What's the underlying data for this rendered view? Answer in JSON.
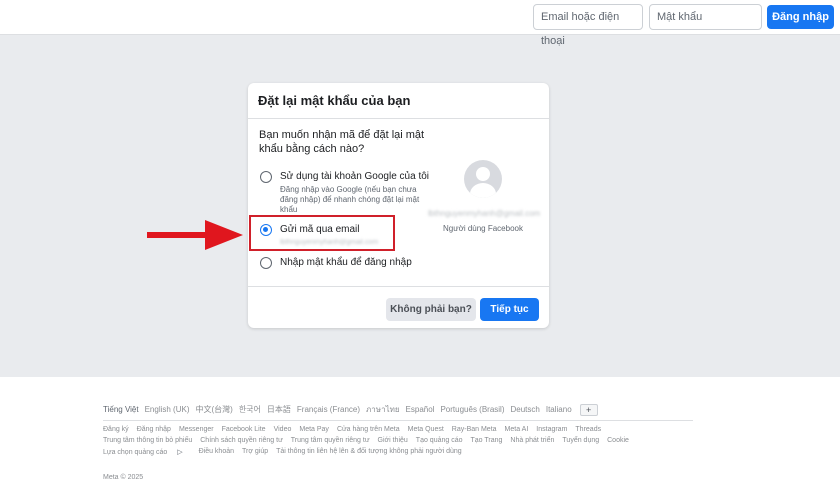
{
  "header": {
    "email_placeholder": "Email hoặc điện thoại",
    "password_placeholder": "Mật khẩu",
    "login_label": "Đăng nhập"
  },
  "card": {
    "title": "Đặt lại mật khẩu của bạn",
    "question": "Bạn muốn nhận mã để đặt lại mật khẩu bằng cách nào?",
    "options": [
      {
        "label": "Sử dụng tài khoản Google của tôi",
        "description": "Đăng nhập vào Google (nếu bạn chưa đăng nhập) để nhanh chóng đặt lại mật khẩu",
        "selected": false
      },
      {
        "label": "Gửi mã qua email",
        "email": "lbthnguyenmyhanh@gmail.com",
        "selected": true
      },
      {
        "label": "Nhập mật khẩu để đăng nhập",
        "selected": false
      }
    ],
    "profile": {
      "email": "lbthnguyenmyhanh@gmail.com",
      "name": "Người dùng Facebook"
    },
    "not_you_label": "Không phải bạn?",
    "continue_label": "Tiếp tục"
  },
  "annotation": {
    "arrow_color": "#e0161e",
    "box_color": "#d0202a"
  },
  "footer": {
    "languages": [
      "Tiếng Việt",
      "English (UK)",
      "中文(台灣)",
      "한국어",
      "日本語",
      "Français (France)",
      "ภาษาไทย",
      "Español",
      "Português (Brasil)",
      "Deutsch",
      "Italiano"
    ],
    "add_language": "+",
    "links_row1": [
      "Đăng ký",
      "Đăng nhập",
      "Messenger",
      "Facebook Lite",
      "Video",
      "Meta Pay",
      "Cửa hàng trên Meta",
      "Meta Quest",
      "Ray-Ban Meta",
      "Meta AI",
      "Instagram",
      "Threads"
    ],
    "links_row2": [
      "Trung tâm thông tin bỏ phiếu",
      "Chính sách quyền riêng tư",
      "Trung tâm quyền riêng tư",
      "Giới thiệu",
      "Tạo quảng cáo",
      "Tạo Trang",
      "Nhà phát triển",
      "Tuyển dụng",
      "Cookie"
    ],
    "links_row3": [
      "Lựa chọn quảng cáo",
      "Điều khoản",
      "Trợ giúp",
      "Tải thông tin liên hệ lên & đối tượng không phải người dùng"
    ],
    "ad_choices_icon": "ad-choices-icon",
    "copyright": "Meta © 2025"
  },
  "colors": {
    "brand": "#1877f2",
    "background": "#e9ebee"
  }
}
